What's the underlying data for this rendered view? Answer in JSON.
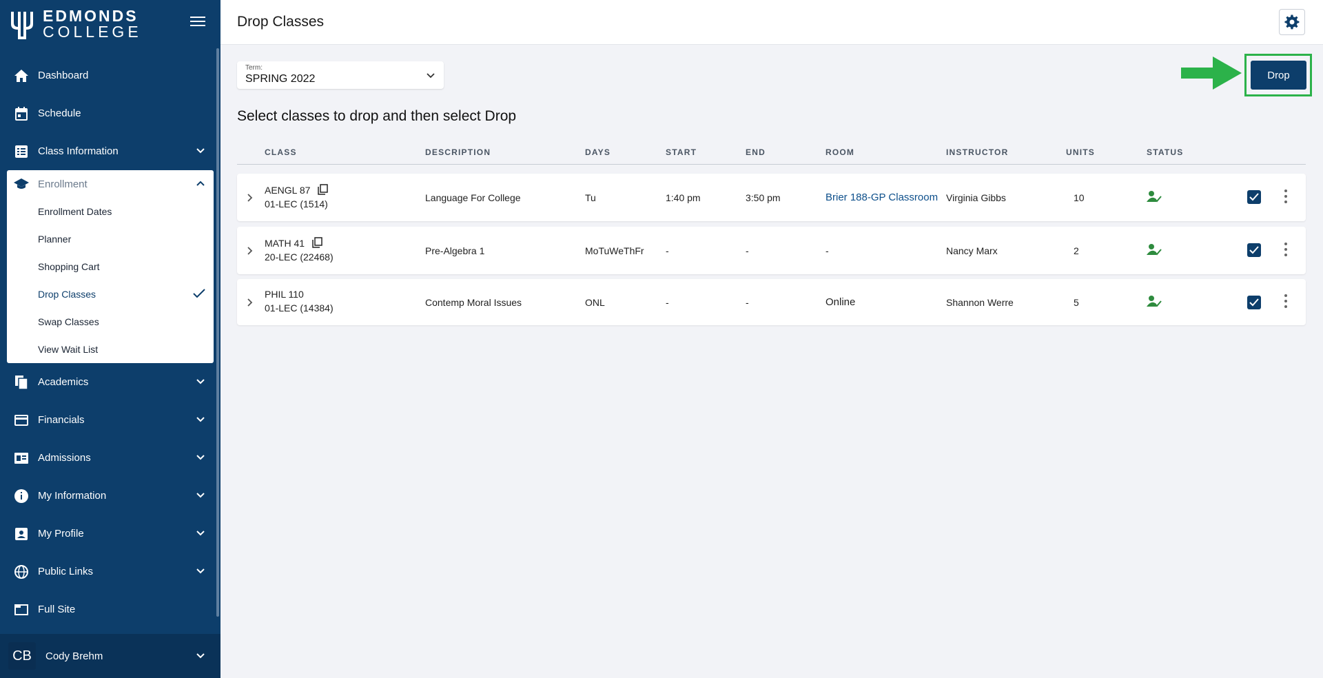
{
  "brand": {
    "line1": "EDMONDS",
    "line2": "COLLEGE"
  },
  "sidebar": {
    "items": [
      {
        "label": "Dashboard",
        "icon": "home-icon"
      },
      {
        "label": "Schedule",
        "icon": "calendar-icon"
      },
      {
        "label": "Class Information",
        "icon": "list-icon"
      }
    ],
    "enrollment": {
      "label": "Enrollment",
      "sub_items": [
        "Enrollment Dates",
        "Planner",
        "Shopping Cart",
        "Drop Classes",
        "Swap Classes",
        "View Wait List"
      ],
      "active": "Drop Classes"
    },
    "lower_items": [
      {
        "label": "Academics",
        "icon": "document-icon"
      },
      {
        "label": "Financials",
        "icon": "credit-card-icon"
      },
      {
        "label": "Admissions",
        "icon": "id-card-icon"
      },
      {
        "label": "My Information",
        "icon": "info-icon"
      },
      {
        "label": "My Profile",
        "icon": "profile-icon"
      },
      {
        "label": "Public Links",
        "icon": "globe-icon"
      },
      {
        "label": "Full Site",
        "icon": "window-icon"
      }
    ],
    "user": {
      "initials": "CB",
      "name": "Cody Brehm"
    }
  },
  "header": {
    "title": "Drop Classes"
  },
  "term": {
    "label": "Term:",
    "value": "SPRING 2022"
  },
  "instructions": "Select classes to drop and then select Drop",
  "drop_button": "Drop",
  "table": {
    "columns": [
      "CLASS",
      "DESCRIPTION",
      "DAYS",
      "START",
      "END",
      "ROOM",
      "INSTRUCTOR",
      "UNITS",
      "STATUS"
    ],
    "rows": [
      {
        "class": "AENGL 87",
        "section": "01-LEC (1514)",
        "description": "Language For College",
        "days": "Tu",
        "start": "1:40 pm",
        "end": "3:50 pm",
        "room": "Brier 188-GP Classroom",
        "instructor": "Virginia Gibbs",
        "units": "10"
      },
      {
        "class": "MATH 41",
        "section": "20-LEC (22468)",
        "description": "Pre-Algebra 1",
        "days": "MoTuWeThFr",
        "start": "-",
        "end": "-",
        "room": "-",
        "instructor": "Nancy Marx",
        "units": "2"
      },
      {
        "class": "PHIL 110",
        "section": "01-LEC (14384)",
        "description": "Contemp Moral Issues",
        "days": "ONL",
        "start": "-",
        "end": "-",
        "room": "Online",
        "instructor": "Shannon Werre",
        "units": "5"
      }
    ]
  },
  "colors": {
    "sidebar": "#0d3e6b",
    "accent_green": "#2cb24a",
    "status_green": "#2e8b3e"
  }
}
